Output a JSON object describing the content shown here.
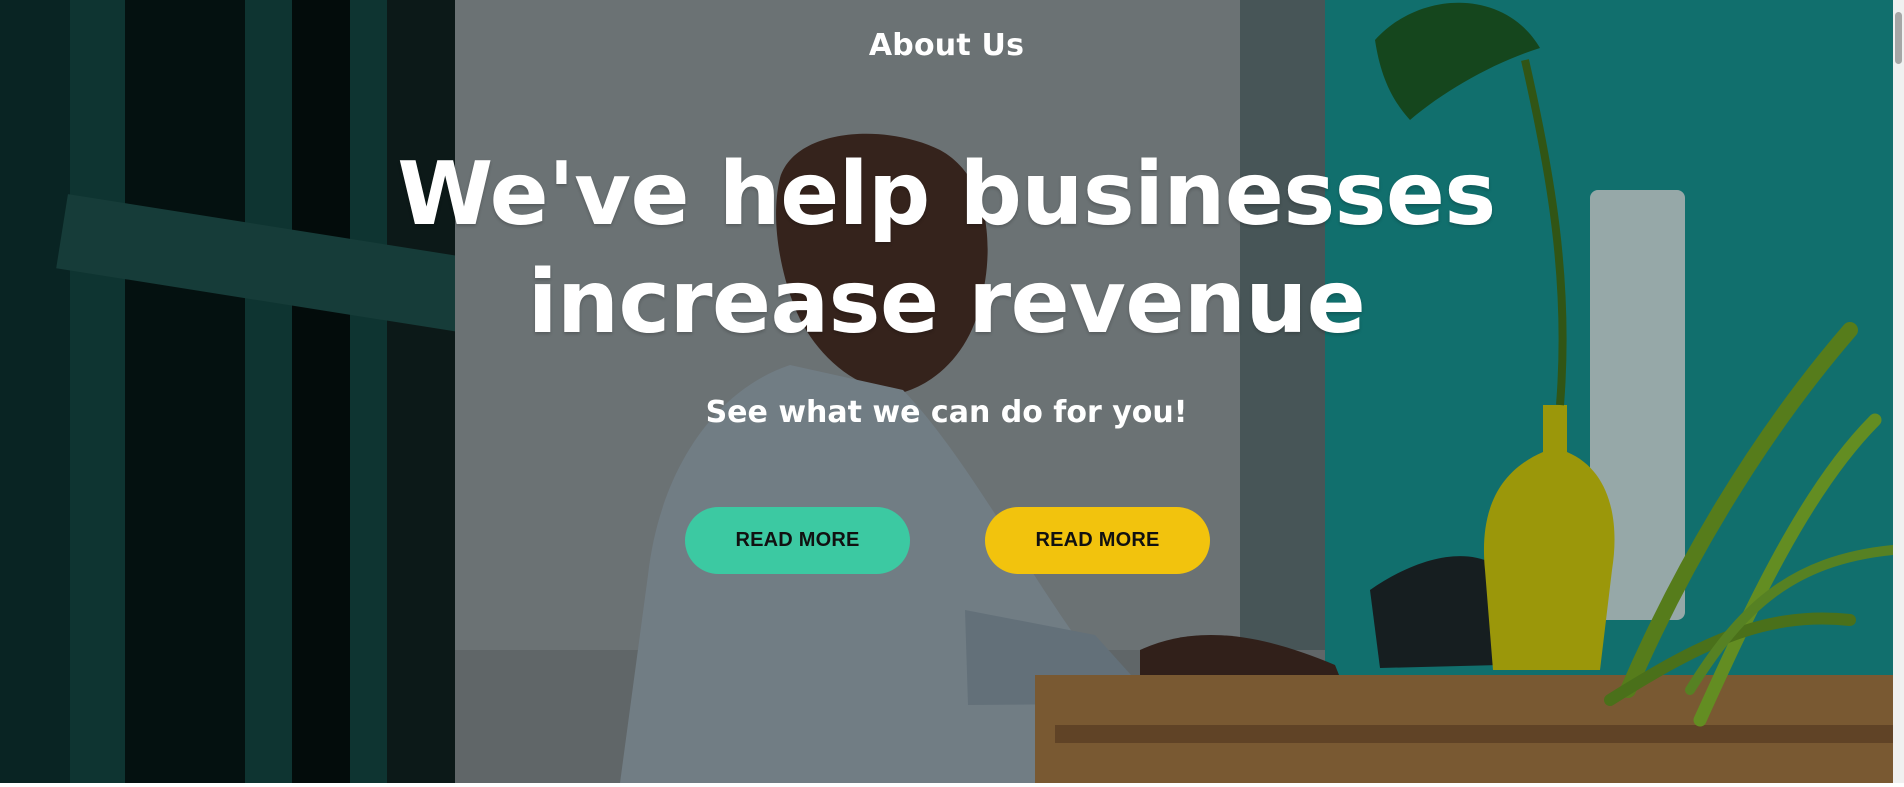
{
  "hero": {
    "eyebrow": "About Us",
    "headline": "We've help businesses increase revenue",
    "subheadline": "See what we can do for you!",
    "buttons": [
      {
        "label": "READ MORE",
        "color": "#3cc9a2"
      },
      {
        "label": "READ MORE",
        "color": "#f2c30d"
      }
    ]
  },
  "colors": {
    "text": "#ffffff",
    "button_text": "#111111",
    "green_button": "#3cc9a2",
    "yellow_button": "#f2c30d",
    "teal_background": "#179694"
  }
}
